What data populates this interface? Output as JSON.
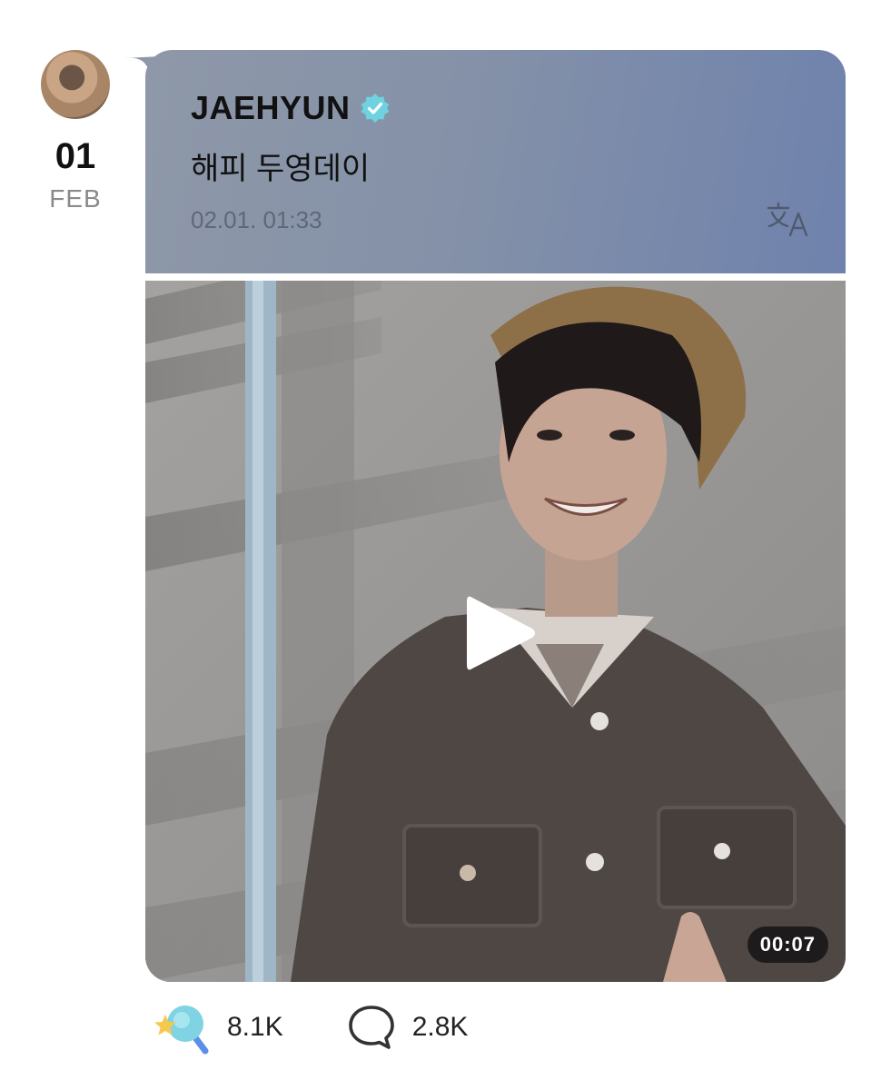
{
  "date": {
    "day": "01",
    "month": "FEB"
  },
  "post": {
    "author": "JAEHYUN",
    "text": "해피 두영데이",
    "timestamp": "02.01. 01:33"
  },
  "video": {
    "duration": "00:07"
  },
  "reactions": {
    "likes": "8.1K",
    "comments": "2.8K"
  },
  "colors": {
    "bubble_start": "#8e98a8",
    "bubble_end": "#6f82ad",
    "verified": "#6fd2e0",
    "lightstick": "#7fd3e3"
  },
  "icons": [
    "verified-badge-icon",
    "translate-icon",
    "play-icon",
    "lightstick-icon",
    "comment-icon"
  ]
}
